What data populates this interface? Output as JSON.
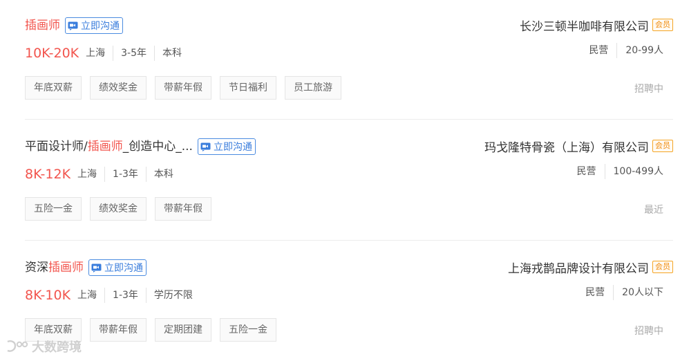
{
  "jobs": [
    {
      "title_pre": "",
      "title_hl": "插画师",
      "title_post": "",
      "chat_label": "立即沟通",
      "salary": "10K-20K",
      "city": "上海",
      "experience": "3-5年",
      "education": "本科",
      "tags": [
        "年底双薪",
        "绩效奖金",
        "带薪年假",
        "节日福利",
        "员工旅游"
      ],
      "company": "长沙三顿半咖啡有限公司",
      "vip": "会员",
      "company_type": "民营",
      "company_size": "20-99人",
      "status": "招聘中"
    },
    {
      "title_pre": "平面设计师/",
      "title_hl": "插画师",
      "title_post": "_创造中心_...",
      "chat_label": "立即沟通",
      "salary": "8K-12K",
      "city": "上海",
      "experience": "1-3年",
      "education": "本科",
      "tags": [
        "五险一金",
        "绩效奖金",
        "带薪年假"
      ],
      "company": "玛戈隆特骨瓷（上海）有限公司",
      "vip": "会员",
      "company_type": "民营",
      "company_size": "100-499人",
      "status": "最近"
    },
    {
      "title_pre": "资深",
      "title_hl": "插画师",
      "title_post": "",
      "chat_label": "立即沟通",
      "salary": "8K-10K",
      "city": "上海",
      "experience": "1-3年",
      "education": "学历不限",
      "tags": [
        "年底双薪",
        "带薪年假",
        "定期团建",
        "五险一金"
      ],
      "company": "上海戎鹊品牌设计有限公司",
      "vip": "会员",
      "company_type": "民营",
      "company_size": "20人以下",
      "status": "招聘中"
    }
  ],
  "watermark": "大数跨境",
  "icons": {
    "chat": "video-chat-icon",
    "watermark": "logo-icon"
  },
  "colors": {
    "highlight": "#f2554e",
    "chat": "#3a7ddc",
    "vip": "#f08c0f",
    "status": "#aaaaaa"
  }
}
